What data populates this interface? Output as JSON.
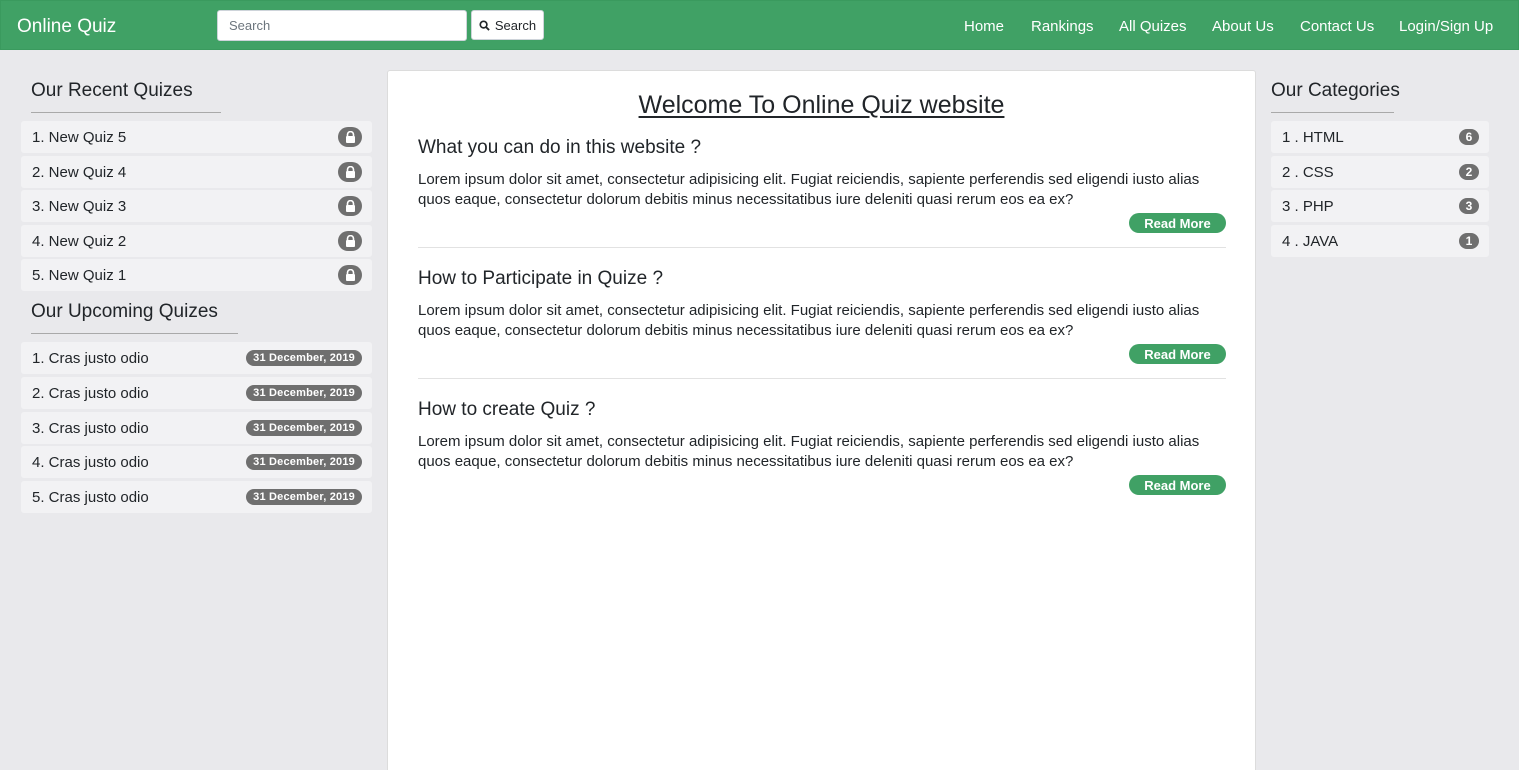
{
  "nav": {
    "brand": "Online Quiz",
    "search_placeholder": "Search",
    "search_button": "Search",
    "links": [
      "Home",
      "Rankings",
      "All Quizes",
      "About Us",
      "Contact Us",
      "Login/Sign Up"
    ]
  },
  "recent": {
    "title": "Our Recent Quizes",
    "items": [
      "1. New Quiz 5",
      "2. New Quiz 4",
      "3. New Quiz 3",
      "4. New Quiz 2",
      "5. New Quiz 1"
    ]
  },
  "upcoming": {
    "title": "Our Upcoming Quizes",
    "items": [
      {
        "label": "1. Cras justo odio",
        "date": "31 December, 2019"
      },
      {
        "label": "2. Cras justo odio",
        "date": "31 December, 2019"
      },
      {
        "label": "3. Cras justo odio",
        "date": "31 December, 2019"
      },
      {
        "label": "4. Cras justo odio",
        "date": "31 December, 2019"
      },
      {
        "label": "5. Cras justo odio",
        "date": "31 December, 2019"
      }
    ]
  },
  "main": {
    "title": "Welcome To Online Quiz website",
    "sections": [
      {
        "heading": "What you can do in this website ?",
        "body": "Lorem ipsum dolor sit amet, consectetur adipisicing elit. Fugiat reiciendis, sapiente perferendis sed eligendi iusto alias quos eaque, consectetur dolorum debitis minus necessitatibus iure deleniti quasi rerum eos ea ex?",
        "button": "Read More"
      },
      {
        "heading": "How to Participate in Quize ?",
        "body": "Lorem ipsum dolor sit amet, consectetur adipisicing elit. Fugiat reiciendis, sapiente perferendis sed eligendi iusto alias quos eaque, consectetur dolorum debitis minus necessitatibus iure deleniti quasi rerum eos ea ex?",
        "button": "Read More"
      },
      {
        "heading": "How to create Quiz ?",
        "body": "Lorem ipsum dolor sit amet, consectetur adipisicing elit. Fugiat reiciendis, sapiente perferendis sed eligendi iusto alias quos eaque, consectetur dolorum debitis minus necessitatibus iure deleniti quasi rerum eos ea ex?",
        "button": "Read More"
      }
    ]
  },
  "categories": {
    "title": "Our Categories",
    "items": [
      {
        "label": "1 . HTML",
        "count": "6"
      },
      {
        "label": "2 . CSS",
        "count": "2"
      },
      {
        "label": "3 . PHP",
        "count": "3"
      },
      {
        "label": "4 . JAVA",
        "count": "1"
      }
    ]
  },
  "colors": {
    "accent": "#40a165",
    "badge": "#6f6f6f",
    "page_bg": "#e9e9ec"
  },
  "icons": {
    "search": "search-icon",
    "lock": "lock-icon"
  }
}
